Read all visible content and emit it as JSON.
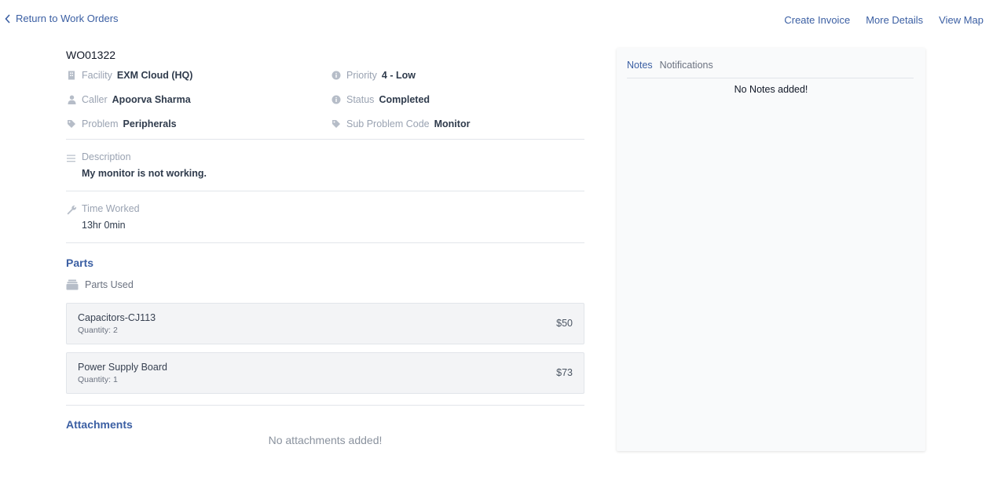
{
  "nav": {
    "back_label": "Return to Work Orders",
    "actions": [
      "Create Invoice",
      "More Details",
      "View Map"
    ]
  },
  "work_order": {
    "id": "WO01322",
    "facility": {
      "label": "Facility",
      "value": "EXM Cloud (HQ)"
    },
    "priority": {
      "label": "Priority",
      "value": "4 - Low"
    },
    "caller": {
      "label": "Caller",
      "value": "Apoorva Sharma"
    },
    "status": {
      "label": "Status",
      "value": "Completed"
    },
    "problem": {
      "label": "Problem",
      "value": "Peripherals"
    },
    "sub_problem": {
      "label": "Sub Problem Code",
      "value": "Monitor"
    },
    "description": {
      "label": "Description",
      "value": "My monitor is not working."
    },
    "time_worked": {
      "label": "Time Worked",
      "value": "13hr 0min"
    }
  },
  "parts": {
    "title": "Parts",
    "used_label": "Parts Used",
    "items": [
      {
        "name": "Capacitors-CJ113",
        "quantity": "Quantity: 2",
        "price": "$50"
      },
      {
        "name": "Power Supply Board",
        "quantity": "Quantity: 1",
        "price": "$73"
      }
    ]
  },
  "attachments": {
    "title": "Attachments",
    "empty": "No attachments added!"
  },
  "notes": {
    "tabs": [
      "Notes",
      "Notifications"
    ],
    "active_tab": "Notes",
    "empty": "No Notes added!"
  },
  "colors": {
    "accent": "#3b5fa3",
    "muted": "#9aa3b2",
    "value": "#2f3b4c",
    "card_bg": "#f3f4f6"
  }
}
